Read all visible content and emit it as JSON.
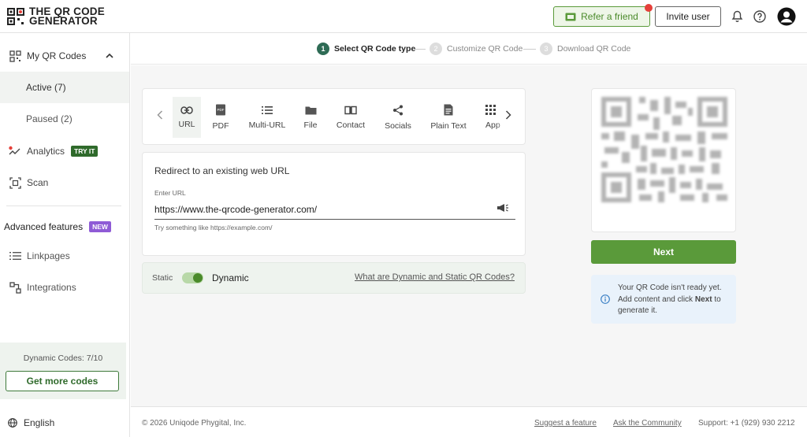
{
  "brand": {
    "line1": "THE QR CODE",
    "line2": "GENERATOR"
  },
  "header": {
    "refer_label": "Refer a friend",
    "invite_label": "Invite user",
    "accent_color": "#5a9a3a",
    "notification_dot_color": "#e5403a"
  },
  "sidebar": {
    "my_qr_codes": "My QR Codes",
    "active": "Active (7)",
    "paused": "Paused (2)",
    "analytics": "Analytics",
    "analytics_badge": "TRY IT",
    "scan": "Scan",
    "advanced": "Advanced features",
    "advanced_badge": "NEW",
    "linkpages": "Linkpages",
    "integrations": "Integrations",
    "codes_count": "Dynamic Codes: 7/10",
    "get_more": "Get more codes",
    "language": "English"
  },
  "stepper": {
    "steps": [
      {
        "num": "1",
        "label": "Select QR Code type"
      },
      {
        "num": "2",
        "label": "Customize QR Code"
      },
      {
        "num": "3",
        "label": "Download QR Code"
      }
    ]
  },
  "types": [
    "URL",
    "PDF",
    "Multi-URL",
    "File",
    "Contact",
    "Socials",
    "Plain Text",
    "App"
  ],
  "url_form": {
    "title": "Redirect to an existing web URL",
    "label": "Enter URL",
    "value": "https://www.the-qrcode-generator.com/",
    "help": "Try something like https://example.com/"
  },
  "toggle": {
    "static": "Static",
    "dynamic": "Dynamic",
    "link": "What are Dynamic and Static QR Codes?"
  },
  "preview": {
    "next": "Next",
    "info_line1": "Your QR Code isn't ready yet.",
    "info_line2": "Add content and click",
    "info_next": "Next",
    "info_line3": "to generate it."
  },
  "footer": {
    "copyright": "© 2026 Uniqode Phygital, Inc.",
    "suggest": "Suggest a feature",
    "community": "Ask the Community",
    "support": "Support:  +1 (929) 930 2212"
  }
}
